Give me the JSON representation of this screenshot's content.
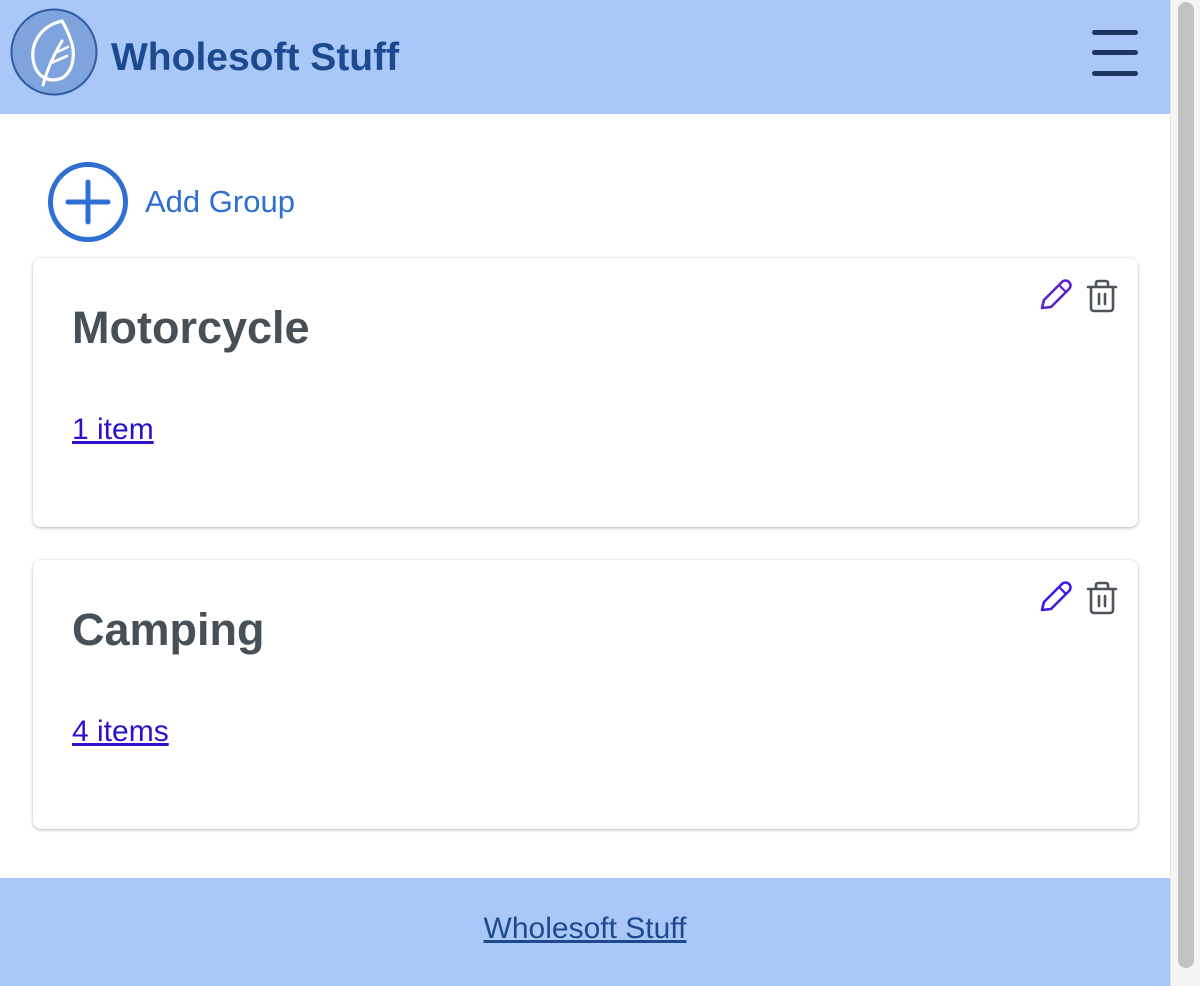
{
  "header": {
    "title": "Wholesoft Stuff",
    "logo_icon": "leaf-icon",
    "menu_icon": "hamburger-menu-icon"
  },
  "actions": {
    "add_group_label": "Add Group"
  },
  "groups": [
    {
      "name": "Motorcycle",
      "items_link": "1 item"
    },
    {
      "name": "Camping",
      "items_link": "4 items"
    }
  ],
  "footer": {
    "link": "Wholesoft Stuff"
  },
  "colors": {
    "header_bg": "#a9c8f8",
    "title": "#1d4a8f",
    "accent": "#2f6fd2",
    "link": "#2a12cc",
    "edit_icon": "#5a22c9"
  }
}
